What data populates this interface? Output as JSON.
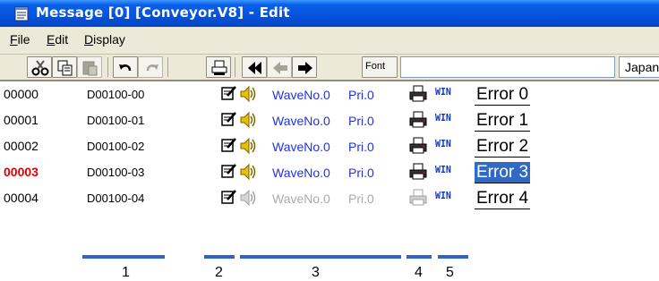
{
  "window": {
    "title": "Message [0] [Conveyor.V8] - Edit"
  },
  "menu": {
    "items": [
      {
        "accel": "F",
        "rest": "ile"
      },
      {
        "accel": "E",
        "rest": "dit"
      },
      {
        "accel": "D",
        "rest": "isplay"
      }
    ]
  },
  "toolbar": {
    "font_button_label": "Font",
    "text_value": "",
    "language_value": "Japanese"
  },
  "rows": [
    {
      "number": "00000",
      "device": "D00100-00",
      "wave": "WaveNo.0",
      "priority": "Pri.0",
      "win": "WIN",
      "message": "Error 0",
      "active": false,
      "selected": false,
      "dim": false
    },
    {
      "number": "00001",
      "device": "D00100-01",
      "wave": "WaveNo.0",
      "priority": "Pri.0",
      "win": "WIN",
      "message": "Error 1",
      "active": false,
      "selected": false,
      "dim": false
    },
    {
      "number": "00002",
      "device": "D00100-02",
      "wave": "WaveNo.0",
      "priority": "Pri.0",
      "win": "WIN",
      "message": "Error 2",
      "active": false,
      "selected": false,
      "dim": false
    },
    {
      "number": "00003",
      "device": "D00100-03",
      "wave": "WaveNo.0",
      "priority": "Pri.0",
      "win": "WIN",
      "message": "Error 3",
      "active": true,
      "selected": true,
      "dim": false
    },
    {
      "number": "00004",
      "device": "D00100-04",
      "wave": "WaveNo.0",
      "priority": "Pri.0",
      "win": "WIN",
      "message": "Error 4",
      "active": false,
      "selected": false,
      "dim": true
    }
  ],
  "callouts": [
    "1",
    "2",
    "3",
    "4",
    "5"
  ],
  "colors": {
    "title_bar": "#0553dc",
    "active_number": "#e00000",
    "wave_text": "#2233dd",
    "selection": "#316ac5",
    "callout_underline": "#2f63c9"
  }
}
